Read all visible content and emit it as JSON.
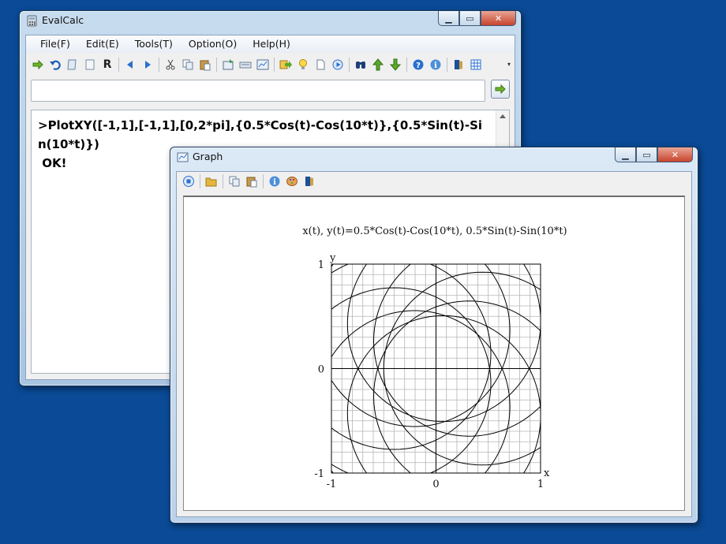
{
  "evalcalc": {
    "title": "EvalCalc",
    "menu": [
      "File(F)",
      "Edit(E)",
      "Tools(T)",
      "Option(O)",
      "Help(H)"
    ],
    "toolbar_icons": [
      "run-arrow-icon",
      "undo-icon",
      "open-script-icon",
      "new-page-icon",
      "r-icon",
      "prev-icon",
      "next-icon",
      "cut-icon",
      "copy-icon",
      "paste-icon",
      "insert-icon",
      "keyboard-icon",
      "graph-icon",
      "export-icon",
      "bulb-icon",
      "blank-doc-icon",
      "play-icon",
      "binoculars-icon",
      "up-arrow-icon",
      "down-arrow-icon",
      "help-icon",
      "info-icon",
      "exit-door-icon",
      "grid-icon"
    ],
    "r_label": "R",
    "input_value": "",
    "output_text": ">PlotXY([-1,1],[-1,1],[0,2*pi],{0.5*Cos(t)-Cos(10*t)},{0.5*Sin(t)-Sin(10*t)}) \n OK!"
  },
  "graph": {
    "title": "Graph",
    "toolbar_icons": [
      "stop-icon",
      "open-folder-icon",
      "copy-icon",
      "paste-icon",
      "info-icon",
      "palette-icon",
      "exit-door-icon"
    ]
  },
  "chart_data": {
    "type": "line",
    "title": "x(t), y(t)=0.5*Cos(t)-Cos(10*t), 0.5*Sin(t)-Sin(10*t)",
    "xlabel": "x",
    "ylabel": "y",
    "xlim": [
      -1,
      1
    ],
    "ylim": [
      -1,
      1
    ],
    "x_ticks": [
      "-1",
      "0",
      "1"
    ],
    "y_ticks": [
      "-1",
      "0",
      "1"
    ],
    "t_range": [
      0,
      6.283185
    ],
    "x_expr": "0.5*Cos(t)-Cos(10*t)",
    "y_expr": "0.5*Sin(t)-Sin(10*t)",
    "grid": true,
    "grid_divisions": 20
  }
}
